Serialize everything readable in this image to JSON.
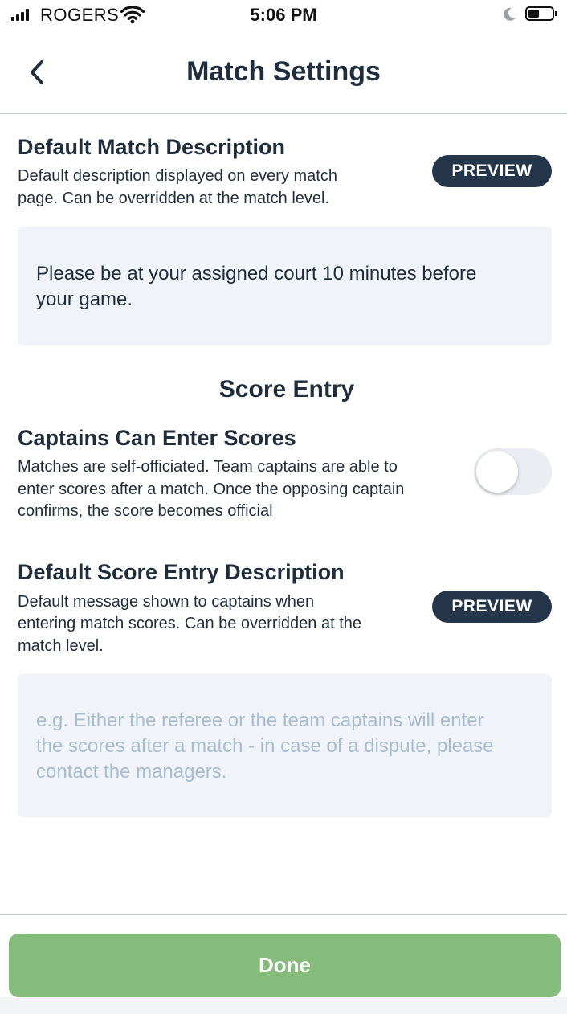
{
  "status_bar": {
    "carrier": "ROGERS",
    "time": "5:06 PM"
  },
  "header": {
    "title": "Match Settings"
  },
  "default_match_description": {
    "title": "Default Match Description",
    "description_line1": "Default description displayed on every match",
    "description_line2": "page. Can be overridden at the match level.",
    "preview_label": "PREVIEW",
    "text_line1": "Please be at your assigned court 10 minutes before",
    "text_line2": "your game."
  },
  "score_entry": {
    "heading": "Score Entry",
    "captains": {
      "title": "Captains Can Enter Scores",
      "description_line1": "Matches are self-officiated.  Team captains are able to",
      "description_line2": "enter scores after a match.  Once the opposing captain",
      "description_line3": "confirms, the score becomes official",
      "toggle_on": false
    },
    "default_description": {
      "title": "Default Score Entry Description",
      "description_line1": "Default message shown to captains when",
      "description_line2": "entering match scores.  Can be overridden at the",
      "description_line3": "match level.",
      "preview_label": "PREVIEW",
      "placeholder_line1": "e.g. Either the referee or the team captains will enter",
      "placeholder_line2": "the scores after a match - in case of a dispute, please",
      "placeholder_line3": "contact the managers."
    }
  },
  "footer": {
    "done_label": "Done"
  },
  "colors": {
    "text": "#1f2d3d",
    "preview_bg": "#26364a",
    "done_bg": "#85bb7b",
    "textbox_bg": "#f0f4f8",
    "placeholder": "#a9bccd"
  }
}
